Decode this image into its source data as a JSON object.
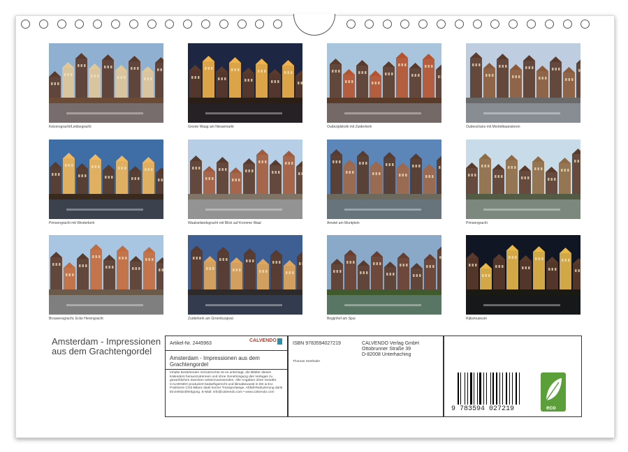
{
  "photos": [
    {
      "caption": "Keizersgracht/Leidsegracht",
      "sky": "#8fb0d0",
      "ground": "#6b4a36",
      "accent": "#e0c89a"
    },
    {
      "caption": "Groote Waag am Nieuwmarkt",
      "sky": "#1d2744",
      "ground": "#2a1e15",
      "accent": "#f2b24a"
    },
    {
      "caption": "Oudezijdskolk mit Zuiderkerk",
      "sky": "#a9c4dd",
      "ground": "#5a3a28",
      "accent": "#b5532e"
    },
    {
      "caption": "Oudeschans mit Montelbaanstoren",
      "sky": "#bfcde0",
      "ground": "#6a6a6a",
      "accent": "#8a5a3a"
    },
    {
      "caption": "Prinsengracht mit Westerkerk",
      "sky": "#3f6ea6",
      "ground": "#3a2a1e",
      "accent": "#f1b75a"
    },
    {
      "caption": "Waalseilandsgracht mit Blick auf Kromme Waal",
      "sky": "#b7cfe6",
      "ground": "#7f7466",
      "accent": "#a45a3a"
    },
    {
      "caption": "Amstel am Muntplein",
      "sky": "#5d86b8",
      "ground": "#6d6a5d",
      "accent": "#a06848"
    },
    {
      "caption": "Prinsengracht",
      "sky": "#c8dbe9",
      "ground": "#545b45",
      "accent": "#8f6a44"
    },
    {
      "caption": "Brouwersgracht, Ecke Herengracht",
      "sky": "#a8c6e2",
      "ground": "#6a5a4a",
      "accent": "#c56a3a"
    },
    {
      "caption": "Zuiderkerk am Groenburgwal",
      "sky": "#3e5f93",
      "ground": "#2c2a2a",
      "accent": "#e1a65a"
    },
    {
      "caption": "Begijnhof am Spui",
      "sky": "#8aa8c8",
      "ground": "#3f5a2d",
      "accent": "#6a3d2a"
    },
    {
      "caption": "Rijksmuseum",
      "sky": "#101624",
      "ground": "#1a1a14",
      "accent": "#e8b84a"
    }
  ],
  "title": "Amsterdam - Impressionen aus dem Grachtengordel",
  "info": {
    "artikel": "Artikel-Nr. 2445963",
    "logo": "CALVENDO",
    "subtitle": "Amsterdam - Impressionen aus dem Grachtengordel",
    "isbn": "ISBN 9783594027219",
    "publisher": "CALVENDO Verlag GmbH",
    "street": "Ottobrunner Straße 39",
    "city": "D-82008 Unterhaching",
    "author": "Thomas Seethaler",
    "legal": "Inhalte bestehender Schutzrechte ist es untersagt, die Blätter dieses Kalenders herauszutrennen und ohne Genehmigung des Verlages zu gewerblichen Zwecken weiterzuverwenden. Alle Angaben ohne Gewähr. CALVENDO produziert bedarfsgerecht und klimabewusst in DE & EU. Positivere CO2-Bilanz dank kurzer Transportwege. Abfall-Reduzierung dank Einzelstückfertigung. E-Mail: info@calvendo.com • www.calvendo.com"
  },
  "barcode": "9 783594 027219",
  "eco_label": "eco",
  "colors": {
    "eco_green": "#5b9f3a",
    "frame": "#333333"
  }
}
